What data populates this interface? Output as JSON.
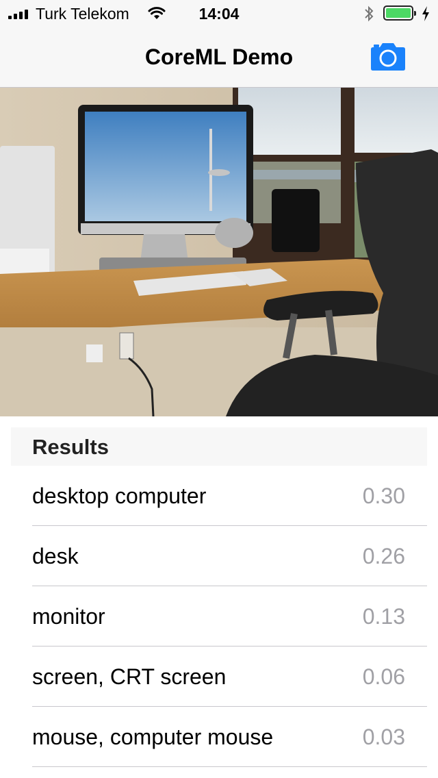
{
  "status_bar": {
    "carrier": "Turk Telekom",
    "time": "14:04",
    "battery_level": 1.0,
    "icons": [
      "signal-icon",
      "wifi-icon",
      "bluetooth-icon",
      "battery-icon",
      "charging-icon"
    ]
  },
  "nav": {
    "title": "CoreML Demo",
    "camera_icon": "camera-icon",
    "accent_color": "#1a82fb"
  },
  "photo": {
    "description_icon": "photo"
  },
  "results": {
    "header": "Results",
    "items": [
      {
        "label": "desktop computer",
        "value": "0.30"
      },
      {
        "label": "desk",
        "value": "0.26"
      },
      {
        "label": "monitor",
        "value": "0.13"
      },
      {
        "label": "screen, CRT screen",
        "value": "0.06"
      },
      {
        "label": "mouse, computer mouse",
        "value": "0.03"
      }
    ]
  }
}
